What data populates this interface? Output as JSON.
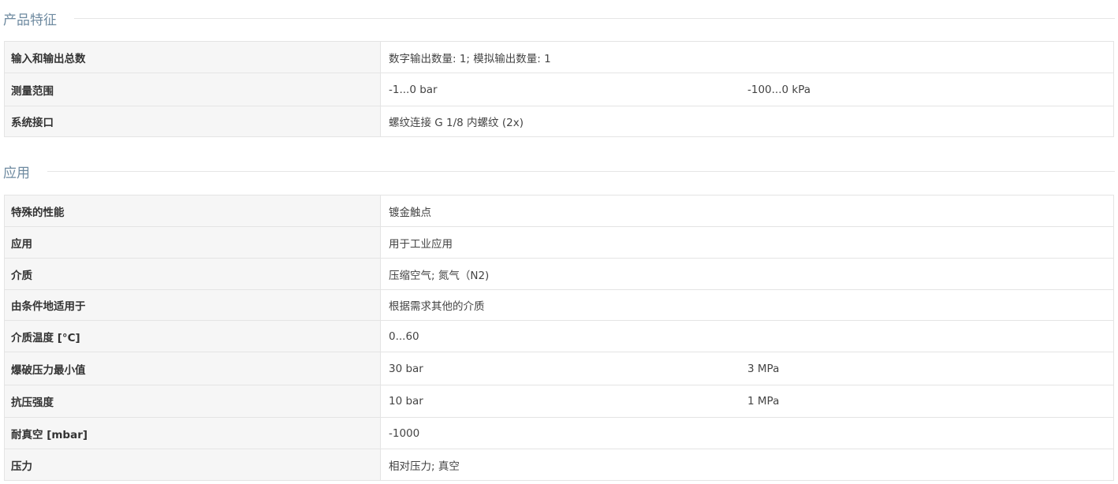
{
  "sections": [
    {
      "title": "产品特征",
      "rows": [
        {
          "label": "输入和输出总数",
          "values": [
            "数字输出数量: 1; 模拟输出数量: 1"
          ]
        },
        {
          "label": "测量范围",
          "values": [
            "-1...0 bar",
            "-100...0 kPa"
          ]
        },
        {
          "label": "系统接口",
          "values": [
            "螺纹连接 G 1/8 内螺纹 (2x)"
          ]
        }
      ]
    },
    {
      "title": "应用",
      "rows": [
        {
          "label": "特殊的性能",
          "values": [
            "镀金触点"
          ]
        },
        {
          "label": "应用",
          "values": [
            "用于工业应用"
          ]
        },
        {
          "label": "介质",
          "values": [
            "压缩空气; 氮气（N2)"
          ]
        },
        {
          "label": "由条件地适用于",
          "values": [
            "根据需求其他的介质"
          ]
        },
        {
          "label": "介质温度 [°C]",
          "values": [
            "0...60"
          ]
        },
        {
          "label": "爆破压力最小值",
          "values": [
            "30 bar",
            "3 MPa"
          ]
        },
        {
          "label": "抗压强度",
          "values": [
            "10 bar",
            "1 MPa"
          ]
        },
        {
          "label": "耐真空 [mbar]",
          "values": [
            "-1000"
          ]
        },
        {
          "label": "压力",
          "values": [
            "相对压力; 真空"
          ]
        }
      ]
    }
  ]
}
